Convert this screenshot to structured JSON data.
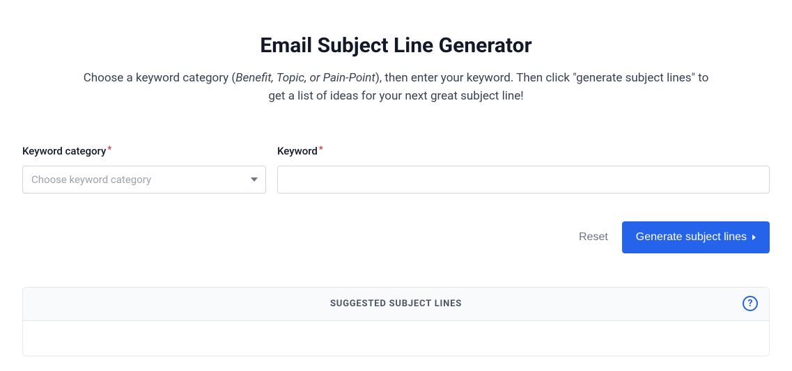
{
  "header": {
    "title": "Email Subject Line Generator",
    "subtitle_pre": "Choose a keyword category (",
    "subtitle_italic": "Benefit, Topic, or Pain-Point",
    "subtitle_post": "), then enter your keyword. Then click \"generate subject lines\" to get a list of ideas for your next great subject line!"
  },
  "form": {
    "category_label": "Keyword category",
    "category_placeholder": "Choose keyword category",
    "category_value": "",
    "keyword_label": "Keyword",
    "keyword_value": ""
  },
  "actions": {
    "reset_label": "Reset",
    "generate_label": "Generate subject lines"
  },
  "results": {
    "header_label": "SUGGESTED SUBJECT LINES"
  }
}
